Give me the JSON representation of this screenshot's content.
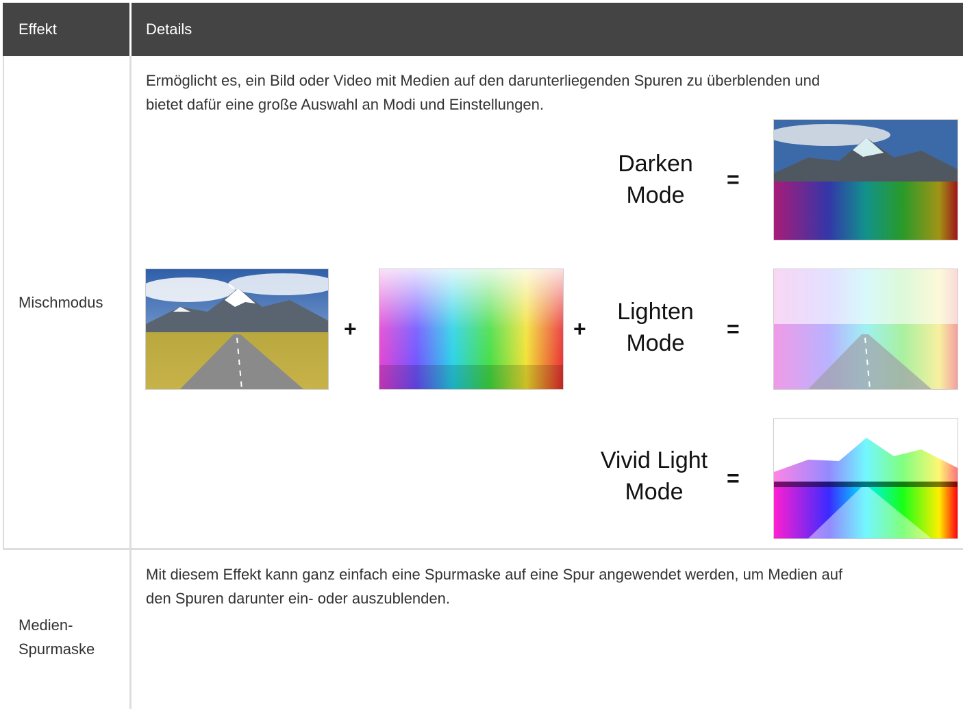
{
  "table": {
    "headers": {
      "effect": "Effekt",
      "details": "Details"
    },
    "rows": [
      {
        "name": "Mischmodus",
        "description_line1": "Ermöglicht es, ein Bild oder Video mit Medien auf den darunterliegenden Spuren zu überblenden und",
        "description_line2": "bietet dafür eine große Auswahl an Modi und Einstellungen."
      },
      {
        "name_line1": "Medien-",
        "name_line2": "Spurmaske",
        "description_line1": "Mit diesem Effekt kann ganz einfach eine Spurmaske auf eine Spur angewendet werden, um Medien auf",
        "description_line2": "den Spuren darunter ein- oder auszublenden."
      }
    ]
  },
  "diagram": {
    "plus": "+",
    "equals": "=",
    "modes": [
      {
        "line1": "Darken",
        "line2": "Mode"
      },
      {
        "line1": "Lighten",
        "line2": "Mode"
      },
      {
        "line1": "Vivid Light",
        "line2": "Mode"
      }
    ]
  },
  "colors": {
    "header_bg": "#444444",
    "header_text": "#ffffff",
    "border": "#dddddd",
    "body_text": "#333333"
  }
}
